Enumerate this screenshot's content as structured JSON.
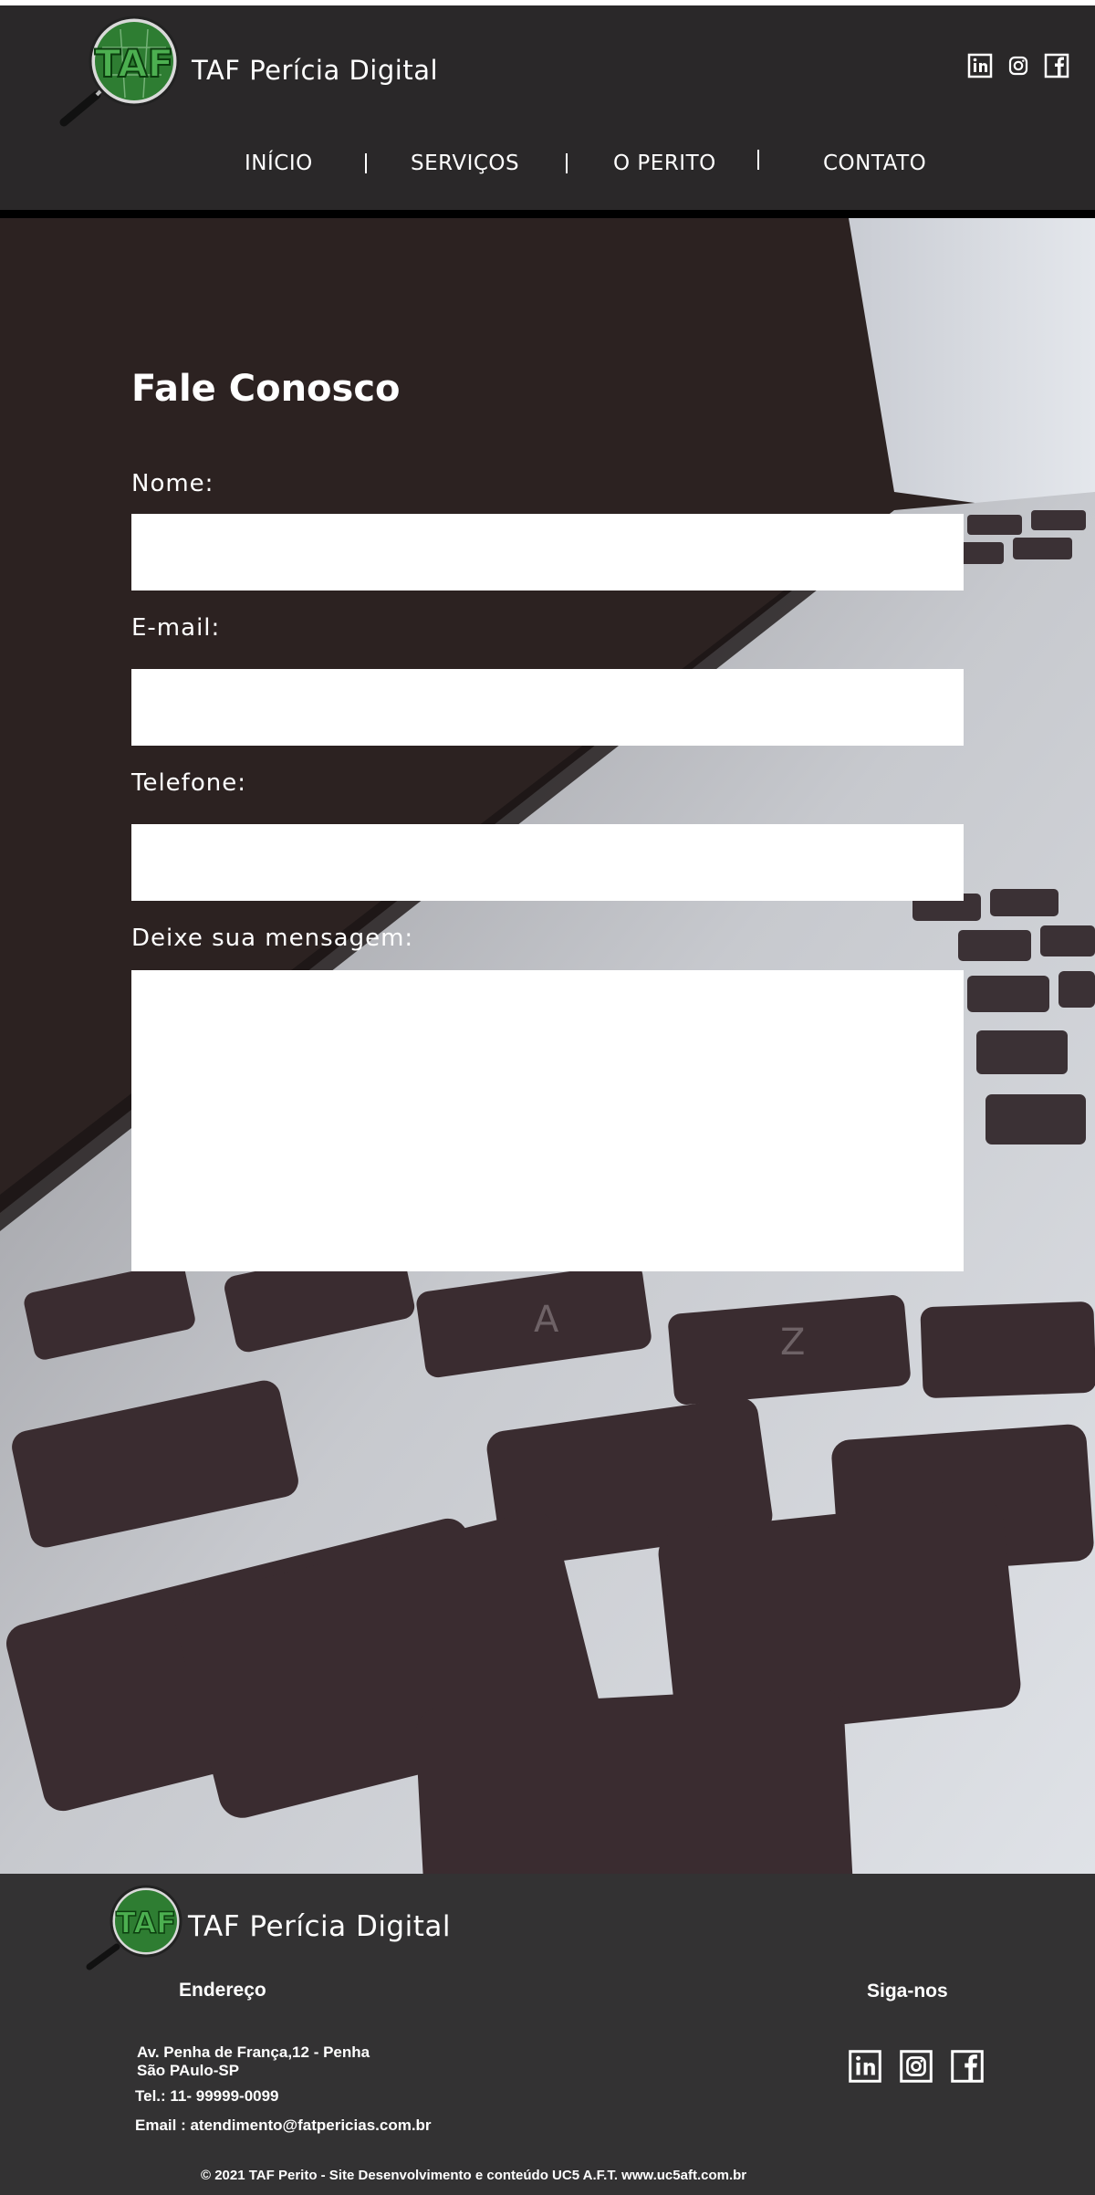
{
  "brand": {
    "name": "TAF Perícia Digital",
    "logo_letters": "TAF"
  },
  "nav": {
    "items": [
      {
        "label": "INÍCIO"
      },
      {
        "label": "SERVIÇOS"
      },
      {
        "label": "O PERITO"
      },
      {
        "label": "CONTATO"
      }
    ],
    "separator": "|"
  },
  "social": {
    "icons": [
      "linkedin-icon",
      "instagram-icon",
      "facebook-icon"
    ],
    "heading": "Siga-nos"
  },
  "form": {
    "title": "Fale Conosco",
    "name_label": "Nome:",
    "name_value": "",
    "email_label": "E-mail:",
    "email_value": "",
    "phone_label": "Telefone:",
    "phone_value": "",
    "message_label": "Deixe sua mensagem:",
    "message_value": ""
  },
  "footer": {
    "brand": "TAF Perícia Digital",
    "address_heading": "Endereço",
    "address_line1": "Av. Penha de França,12 - Penha",
    "address_line2": "São PAulo-SP",
    "phone": "Tel.: 11- 99999-0099",
    "email": "Email :  atendimento@fatpericias.com.br",
    "copyright": "© 2021 TAF Perito  - Site Desenvolvimento e conteúdo UC5 A.F.T.  www.uc5aft.com.br"
  },
  "colors": {
    "header_bg": "#2a2829",
    "footer_bg": "#333233",
    "logo_green": "#2e7d32",
    "text": "#ffffff"
  }
}
